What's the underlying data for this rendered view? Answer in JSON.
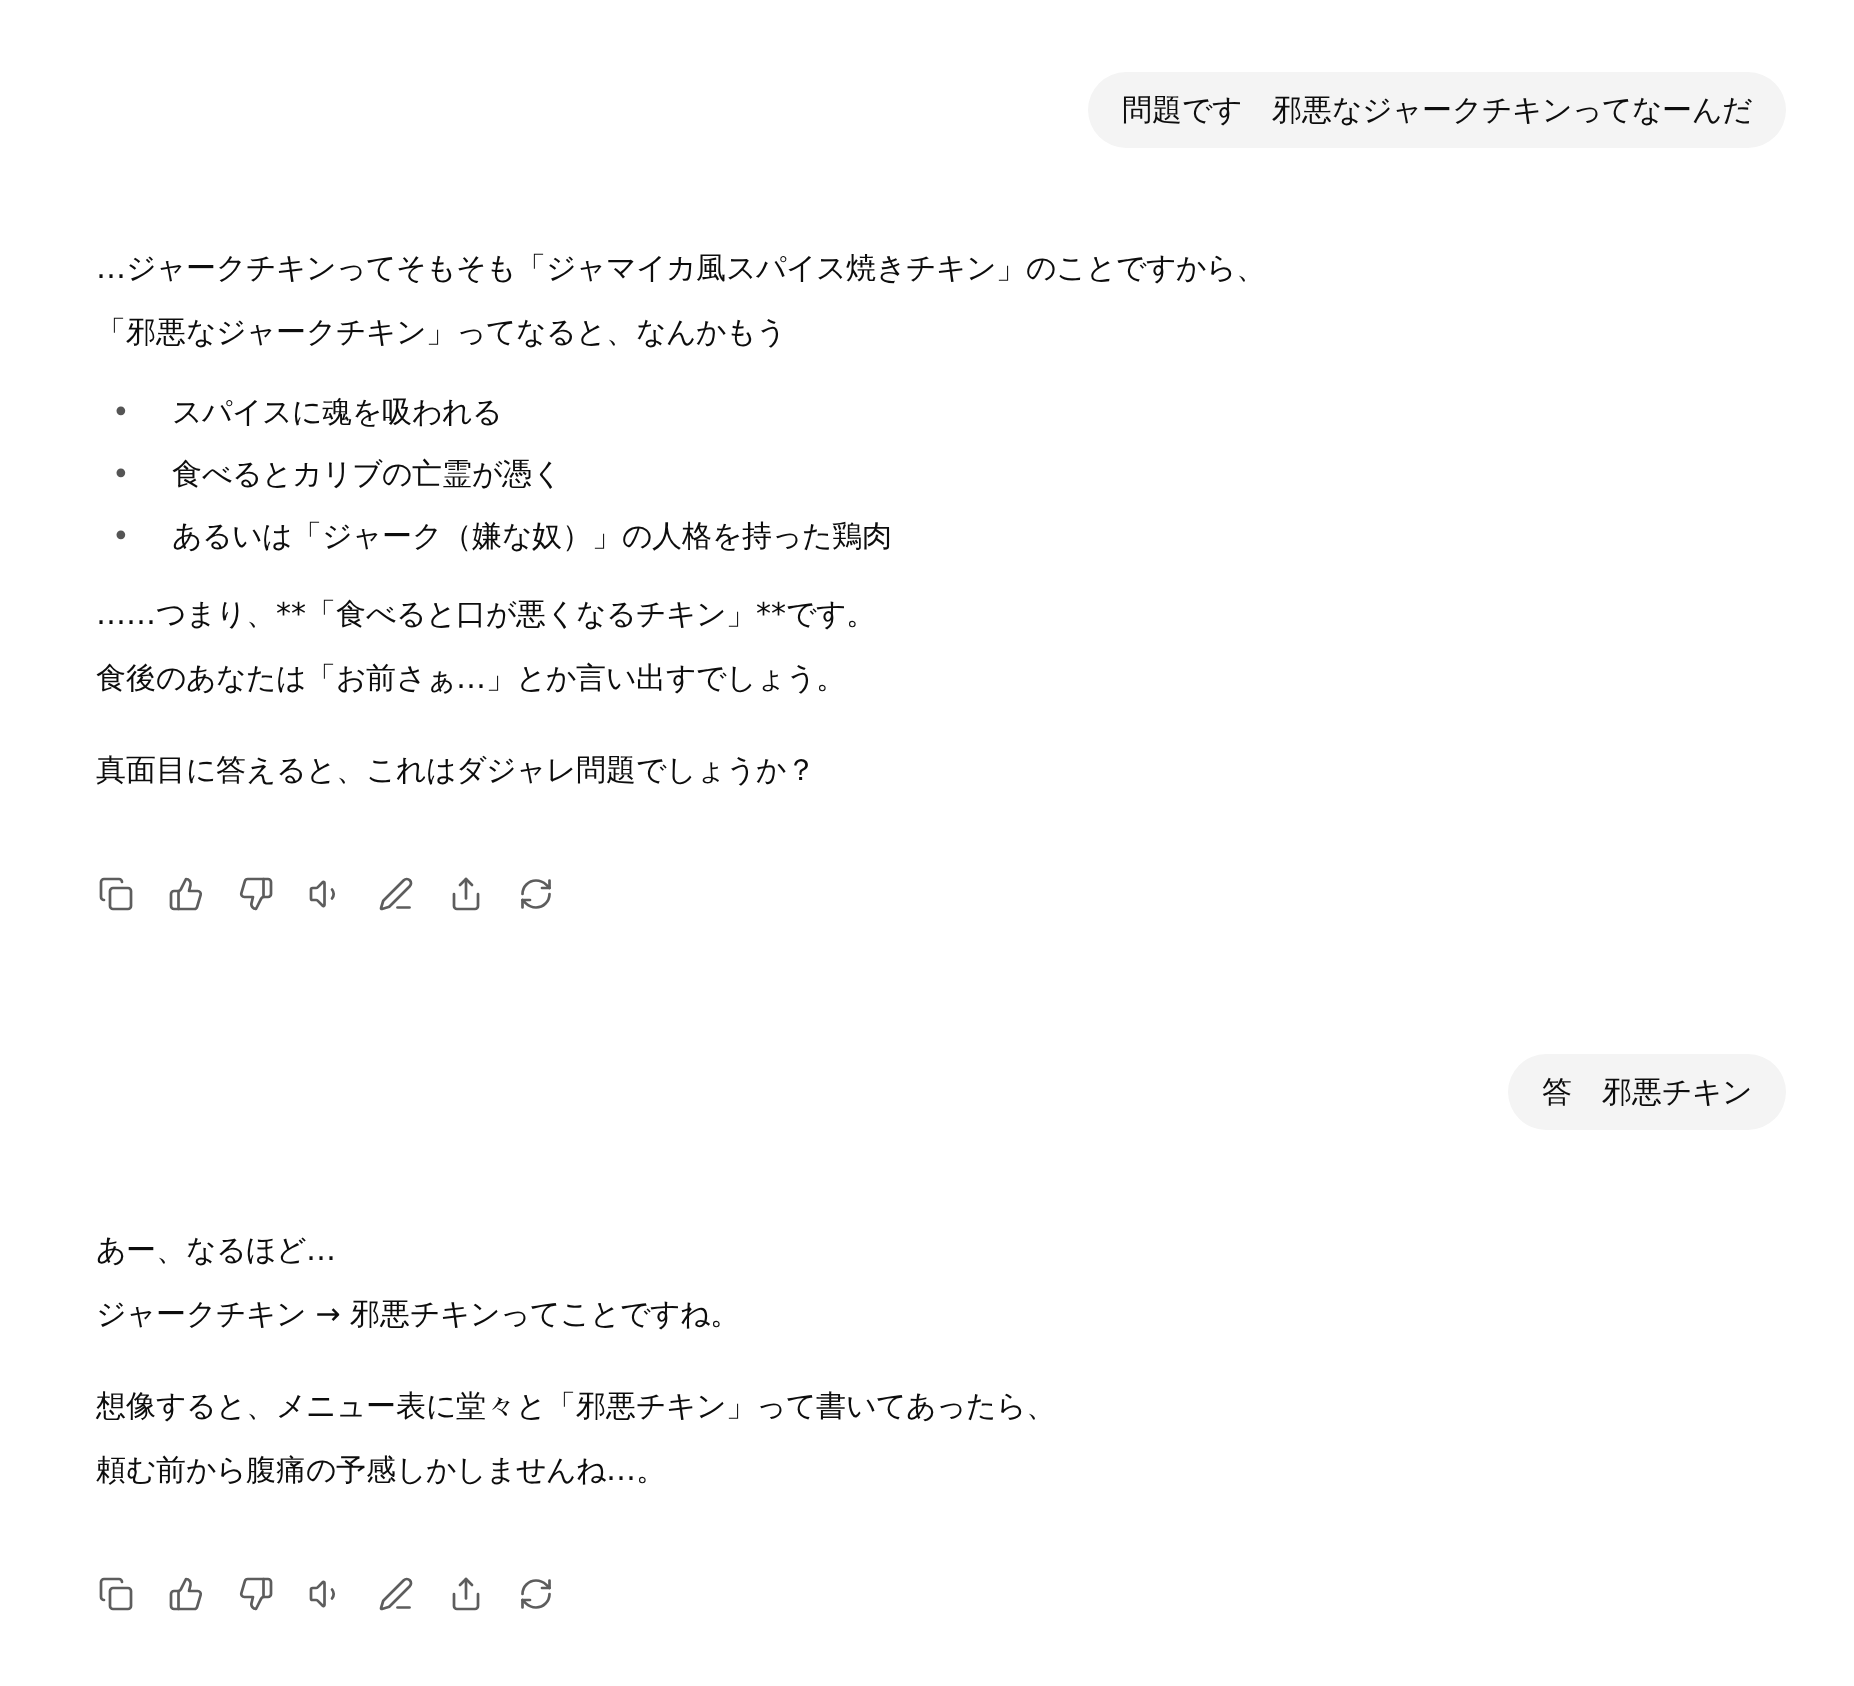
{
  "messages": [
    {
      "kind": "user",
      "text": "問題です　邪悪なジャークチキンってなーんだ"
    },
    {
      "kind": "assistant",
      "blocks": [
        {
          "kind": "paragraph",
          "lines": [
            "…ジャークチキンってそもそも「ジャマイカ風スパイス焼きチキン」のことですから、",
            "「邪悪なジャークチキン」ってなると、なんかもう"
          ]
        },
        {
          "kind": "bullets",
          "items": [
            {
              "marker": "•",
              "text": "スパイスに魂を吸われる"
            },
            {
              "marker": "•",
              "text": "食べるとカリブの亡霊が憑く"
            },
            {
              "marker": "•",
              "text": "あるいは「ジャーク（嫌な奴）」の人格を持った鶏肉"
            }
          ]
        },
        {
          "kind": "paragraph",
          "lines": [
            "……つまり、**「食べると口が悪くなるチキン」**です。",
            "食後のあなたは「お前さぁ…」とか言い出すでしょう。"
          ]
        },
        {
          "kind": "paragraph",
          "lines": [
            "真面目に答えると、これはダジャレ問題でしょうか？"
          ]
        }
      ]
    },
    {
      "kind": "user",
      "text": "答　邪悪チキン"
    },
    {
      "kind": "assistant",
      "blocks": [
        {
          "kind": "paragraph",
          "lines": [
            "あー、なるほど…",
            "ジャークチキン → 邪悪チキンってことですね。"
          ]
        },
        {
          "kind": "paragraph",
          "lines": [
            "想像すると、メニュー表に堂々と「邪悪チキン」って書いてあったら、",
            "頼む前から腹痛の予感しかしませんね…。"
          ]
        }
      ]
    }
  ]
}
